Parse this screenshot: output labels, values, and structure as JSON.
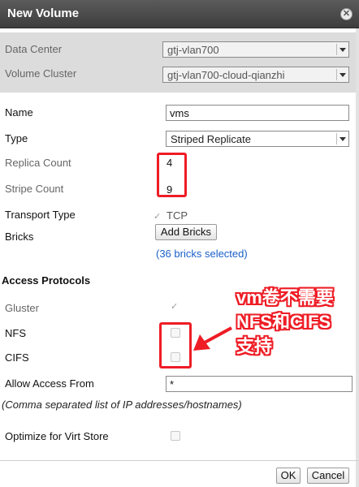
{
  "dialog": {
    "title": "New Volume",
    "close_symbol": "✕"
  },
  "form": {
    "data_center": {
      "label": "Data Center",
      "value": "gtj-vlan700"
    },
    "volume_cluster": {
      "label": "Volume Cluster",
      "value": "gtj-vlan700-cloud-qianzhi"
    },
    "name": {
      "label": "Name",
      "value": "vms"
    },
    "type": {
      "label": "Type",
      "value": "Striped Replicate"
    },
    "replica_count": {
      "label": "Replica Count",
      "value": "4"
    },
    "stripe_count": {
      "label": "Stripe Count",
      "value": "9"
    },
    "transport_type": {
      "label": "Transport Type",
      "option": "TCP",
      "checked": true
    },
    "bricks": {
      "label": "Bricks",
      "button": "Add Bricks",
      "selected_text": "(36 bricks selected)"
    }
  },
  "access_protocols": {
    "heading": "Access Protocols",
    "gluster": {
      "label": "Gluster",
      "checked": true
    },
    "nfs": {
      "label": "NFS",
      "checked": false
    },
    "cifs": {
      "label": "CIFS",
      "checked": false
    },
    "allow_access_from": {
      "label": "Allow Access From",
      "value": "*"
    },
    "hint": "(Comma separated list of IP addresses/hostnames)"
  },
  "optimize_virt_store": {
    "label": "Optimize for Virt Store",
    "checked": false
  },
  "footer": {
    "ok_label": "OK",
    "cancel_label": "Cancel"
  },
  "annotation": {
    "lines": [
      "vm卷不需要",
      "NFS和CIFS",
      "支持"
    ],
    "color": "#ee1c25"
  },
  "icons": {
    "checked_mark": "✓"
  }
}
